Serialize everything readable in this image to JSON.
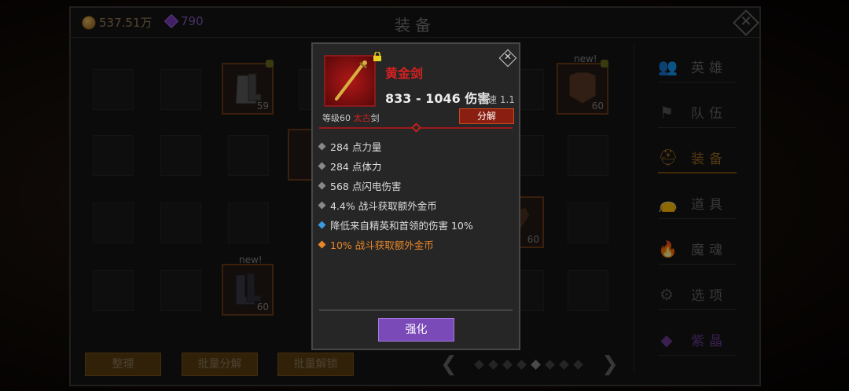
{
  "header": {
    "gold": "537.51万",
    "gems": "790",
    "title": "装备",
    "close_icon": "close-icon"
  },
  "inventory": {
    "items": [
      {
        "name": "boots-armor",
        "level": "59",
        "new_label": ""
      },
      {
        "name": "body-armor",
        "level": "60",
        "new_label": "new!"
      },
      {
        "name": "gauntlet",
        "level": "60",
        "new_label": ""
      },
      {
        "name": "boots-dark",
        "level": "60",
        "new_label": "new!"
      }
    ]
  },
  "menu": {
    "items": [
      {
        "label": "英雄",
        "icon": "heroes-icon"
      },
      {
        "label": "队伍",
        "icon": "flag-icon"
      },
      {
        "label": "装备",
        "icon": "helmet-icon"
      },
      {
        "label": "道具",
        "icon": "bag-icon"
      },
      {
        "label": "魔魂",
        "icon": "flame-icon"
      },
      {
        "label": "选项",
        "icon": "gear-icon"
      },
      {
        "label": "紫晶",
        "icon": "amethyst-icon"
      }
    ],
    "active_index": 2
  },
  "bottom": {
    "sort_label": "整理",
    "bulk_dismantle_label": "批量分解",
    "bulk_unlock_label": "批量解锁",
    "page_count": 8,
    "current_page": 4,
    "prev_icon": "chevron-left-icon",
    "next_icon": "chevron-right-icon"
  },
  "popup": {
    "item_name": "黄金剑",
    "damage": "833 - 1046 伤害",
    "speed": "攻速 1.1",
    "level_prefix": "等级60",
    "item_type": "太古",
    "item_category": "剑",
    "dismantle_label": "分解",
    "stats": [
      {
        "text": "284 点力量",
        "kind": "normal"
      },
      {
        "text": "284 点体力",
        "kind": "normal"
      },
      {
        "text": "568 点闪电伤害",
        "kind": "normal"
      },
      {
        "text": "4.4% 战斗获取额外金币",
        "kind": "normal"
      },
      {
        "text": "降低来自精英和首领的伤害 10%",
        "kind": "blue"
      },
      {
        "text": "10% 战斗获取额外金币",
        "kind": "orange"
      }
    ],
    "enhance_label": "强化",
    "colors": {
      "name": "#d82020",
      "legendary": "#e8862a",
      "magic": "#3a9ae0",
      "enhance": "#7a4ab8"
    }
  }
}
